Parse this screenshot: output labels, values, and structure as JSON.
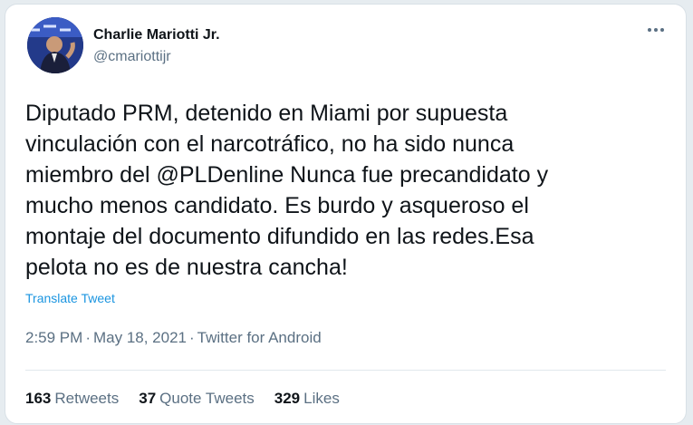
{
  "author": {
    "name": "Charlie Mariotti Jr.",
    "handle": "@cmariottijr"
  },
  "tweet": {
    "text": "Diputado PRM, detenido en Miami por supuesta\nvinculación con el narcotráfico, no ha sido nunca\nmiembro del @PLDenline Nunca fue precandidato y\nmucho menos candidato. Es burdo y asqueroso el\nmontaje del documento difundido en las redes.Esa\npelota no es de nuestra cancha!",
    "translate_label": "Translate Tweet",
    "time": "2:59 PM",
    "date": "May 18, 2021",
    "source": "Twitter for Android",
    "separator": "·"
  },
  "stats": {
    "retweets_count": "163",
    "retweets_label": "Retweets",
    "quotes_count": "37",
    "quotes_label": "Quote Tweets",
    "likes_count": "329",
    "likes_label": "Likes"
  },
  "icons": {
    "more": "more-options-icon"
  },
  "colors": {
    "text": "#0f1419",
    "secondary": "#5b7083",
    "link": "#1b95e0"
  }
}
